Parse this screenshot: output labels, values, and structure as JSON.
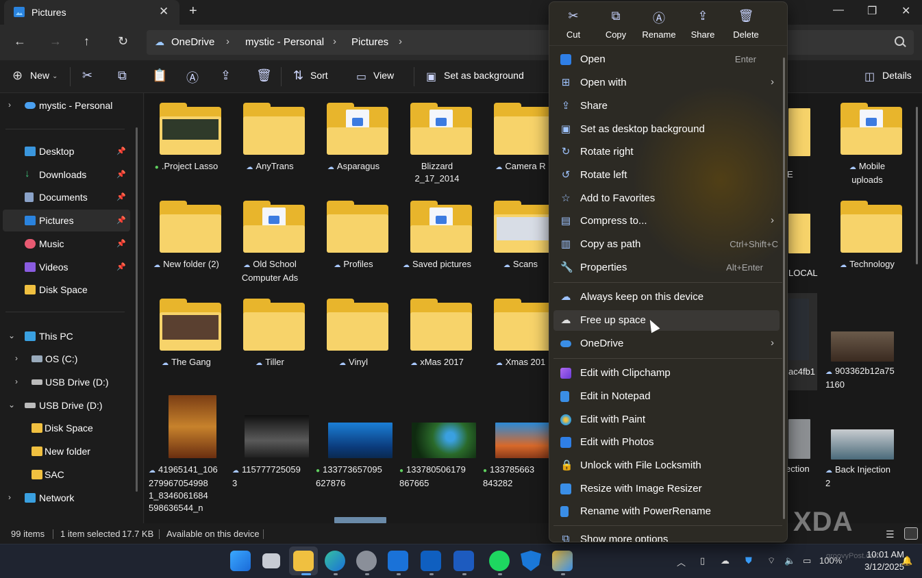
{
  "window": {
    "tab_title": "Pictures",
    "close_tab": "✕",
    "new_tab": "+",
    "minimize": "—",
    "maximize": "❐",
    "close": "✕"
  },
  "address": {
    "crumbs": [
      "OneDrive",
      "mystic - Personal",
      "Pictures"
    ],
    "sep": "›"
  },
  "toolbar": {
    "new_label": "New",
    "sort_label": "Sort",
    "view_label": "View",
    "set_bg_label": "Set as background",
    "details_label": "Details"
  },
  "sidebar": {
    "items": [
      {
        "label": "mystic - Personal",
        "icon": "onedrive-cloud-icon",
        "color": "#4aa0f0"
      },
      {
        "label": "Desktop",
        "icon": "desktop-icon",
        "color": "#3a96dd",
        "pinned": true
      },
      {
        "label": "Downloads",
        "icon": "download-icon",
        "color": "#3ec27a",
        "pinned": true
      },
      {
        "label": "Documents",
        "icon": "documents-icon",
        "color": "#8aa2c8",
        "pinned": true
      },
      {
        "label": "Pictures",
        "icon": "pictures-icon",
        "color": "#2a83de",
        "pinned": true
      },
      {
        "label": "Music",
        "icon": "music-icon",
        "color": "#e85a72",
        "pinned": true
      },
      {
        "label": "Videos",
        "icon": "videos-icon",
        "color": "#8a5ce0",
        "pinned": true
      },
      {
        "label": "Disk Space",
        "icon": "folder-icon",
        "color": "#f0c040"
      },
      {
        "label": "This PC",
        "icon": "this-pc-icon",
        "color": "#3aa0e0"
      },
      {
        "label": "OS (C:)",
        "icon": "drive-icon",
        "color": "#9ab"
      },
      {
        "label": "USB Drive (D:)",
        "icon": "usb-drive-icon",
        "color": "#bbb"
      },
      {
        "label": "USB Drive (D:)",
        "icon": "usb-drive-icon",
        "color": "#bbb"
      },
      {
        "label": "Disk Space",
        "icon": "folder-icon",
        "color": "#f0c040"
      },
      {
        "label": "New folder",
        "icon": "folder-icon",
        "color": "#f0c040"
      },
      {
        "label": "SAC",
        "icon": "folder-icon",
        "color": "#f0c040"
      },
      {
        "label": "Network",
        "icon": "network-icon",
        "color": "#3aa0e0"
      }
    ]
  },
  "items": [
    {
      "l1": ".Project Lasso",
      "l2": "",
      "status": "ok",
      "kind": "photo"
    },
    {
      "l1": "AnyTrans",
      "l2": "",
      "status": "cloud",
      "kind": "plain"
    },
    {
      "l1": "Asparagus",
      "l2": "",
      "status": "cloud",
      "kind": "doc"
    },
    {
      "l1": "Blizzard",
      "l2": "2_17_2014",
      "status": "",
      "kind": "doc"
    },
    {
      "l1": "Camera R",
      "l2": "",
      "status": "cloud",
      "kind": "plain"
    },
    {
      "l1": "New folder (2)",
      "l2": "",
      "status": "cloud",
      "kind": "plain"
    },
    {
      "l1": "Old School",
      "l2": "Computer Ads",
      "status": "cloud",
      "kind": "doc"
    },
    {
      "l1": "Profiles",
      "l2": "",
      "status": "cloud",
      "kind": "plain"
    },
    {
      "l1": "Saved pictures",
      "l2": "",
      "status": "cloud",
      "kind": "doc"
    },
    {
      "l1": "Scans",
      "l2": "",
      "status": "cloud",
      "kind": "plain"
    },
    {
      "l1": "The Gang",
      "l2": "",
      "status": "cloud",
      "kind": "photo"
    },
    {
      "l1": "Tiller",
      "l2": "",
      "status": "cloud",
      "kind": "plain"
    },
    {
      "l1": "Vinyl",
      "l2": "",
      "status": "cloud",
      "kind": "plain"
    },
    {
      "l1": "xMas 2017",
      "l2": "",
      "status": "cloud",
      "kind": "plain"
    },
    {
      "l1": "Xmas 201",
      "l2": "",
      "status": "cloud",
      "kind": "plain"
    },
    {
      "l1": "Mobile",
      "l2": "uploads",
      "status": "cloud",
      "kind": "doc"
    },
    {
      "l1": "Technology",
      "l2": "",
      "status": "cloud",
      "kind": "plain"
    }
  ],
  "photos": [
    {
      "l1": "41965141_106",
      "l2": "279967054998",
      "l3": "1_8346061684",
      "l4": "598636544_n",
      "status": "cloud"
    },
    {
      "l1": "115777725059",
      "l2": "3",
      "l3": "",
      "l4": "",
      "status": "cloud"
    },
    {
      "l1": "133773657095",
      "l2": "627876",
      "l3": "",
      "l4": "",
      "status": "ok"
    },
    {
      "l1": "133780506179",
      "l2": "867665",
      "l3": "",
      "l4": "",
      "status": "ok"
    },
    {
      "l1": "133785663",
      "l2": "843282",
      "l3": "",
      "l4": "",
      "status": "ok"
    },
    {
      "l1": "903362b12a75",
      "l2": "1160",
      "l3": "",
      "l4": "",
      "status": "cloud"
    },
    {
      "l1": "Back Injection",
      "l2": "2",
      "l3": "",
      "l4": "",
      "status": "cloud"
    }
  ],
  "partial_labels": {
    "e_label": "E",
    "local_label": "LOCAL",
    "ac_label": "ac4fb1",
    "inj_label": "ection"
  },
  "status": {
    "count": "99 items",
    "selected": "1 item selected",
    "size": "17.7 KB",
    "availability": "Available on this device"
  },
  "context_menu": {
    "quick": [
      {
        "label": "Cut",
        "icon": "cut-icon"
      },
      {
        "label": "Copy",
        "icon": "copy-icon"
      },
      {
        "label": "Rename",
        "icon": "rename-icon"
      },
      {
        "label": "Share",
        "icon": "share-icon"
      },
      {
        "label": "Delete",
        "icon": "delete-icon"
      }
    ],
    "items": [
      {
        "label": "Open",
        "shortcut": "Enter",
        "icon": "photos-icon",
        "color": "#2f7fe6"
      },
      {
        "label": "Open with",
        "shortcut": "",
        "icon": "open-with-icon",
        "arrow": true
      },
      {
        "label": "Share",
        "shortcut": "",
        "icon": "share-icon"
      },
      {
        "label": "Set as desktop background",
        "shortcut": "",
        "icon": "desktop-background-icon"
      },
      {
        "label": "Rotate right",
        "shortcut": "",
        "icon": "rotate-right-icon"
      },
      {
        "label": "Rotate left",
        "shortcut": "",
        "icon": "rotate-left-icon"
      },
      {
        "label": "Add to Favorites",
        "shortcut": "",
        "icon": "star-icon"
      },
      {
        "label": "Compress to...",
        "shortcut": "",
        "icon": "zip-icon",
        "arrow": true
      },
      {
        "label": "Copy as path",
        "shortcut": "Ctrl+Shift+C",
        "icon": "copy-path-icon"
      },
      {
        "label": "Properties",
        "shortcut": "Alt+Enter",
        "icon": "properties-icon"
      },
      {
        "label": "Always keep on this device",
        "shortcut": "",
        "icon": "keep-cloud-icon"
      },
      {
        "label": "Free up space",
        "shortcut": "",
        "icon": "free-space-cloud-icon"
      },
      {
        "label": "OneDrive",
        "shortcut": "",
        "icon": "onedrive-icon",
        "arrow": true,
        "color": "#3a8ee6"
      },
      {
        "label": "Edit with Clipchamp",
        "shortcut": "",
        "icon": "clipchamp-icon",
        "color": "#8a4ce0"
      },
      {
        "label": "Edit in Notepad",
        "shortcut": "",
        "icon": "notepad-icon",
        "color": "#3a8ee6"
      },
      {
        "label": "Edit with Paint",
        "shortcut": "",
        "icon": "paint-icon",
        "color": "#3aa0d8"
      },
      {
        "label": "Edit with Photos",
        "shortcut": "",
        "icon": "photos-icon",
        "color": "#2f7fe6"
      },
      {
        "label": "Unlock with File Locksmith",
        "shortcut": "",
        "icon": "lock-icon",
        "color": "#cfcfcf"
      },
      {
        "label": "Resize with Image Resizer",
        "shortcut": "",
        "icon": "image-resizer-icon",
        "color": "#3a8ee6"
      },
      {
        "label": "Rename with PowerRename",
        "shortcut": "",
        "icon": "power-rename-icon",
        "color": "#3a8ee6"
      },
      {
        "label": "Show more options",
        "shortcut": "",
        "icon": "more-options-icon"
      }
    ]
  },
  "tray": {
    "battery": "100%",
    "time": "10:01 AM",
    "date": "3/12/2025"
  },
  "watermark": "XDA",
  "watermark2": "groovyPost.com"
}
